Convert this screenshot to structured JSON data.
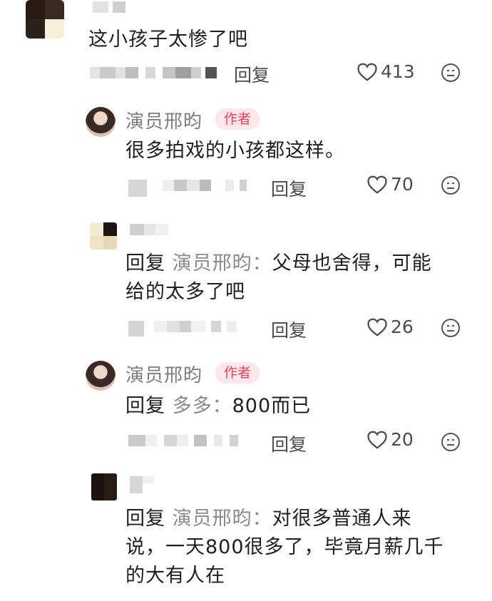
{
  "comments": [
    {
      "text": "这小孩子太惨了吧",
      "reply_label": "回复",
      "likes": "413"
    },
    {
      "author": "演员邢昀",
      "badge": "作者",
      "text": "很多拍戏的小孩都这样。",
      "reply_label": "回复",
      "likes": "70"
    },
    {
      "reply_prefix": "回复",
      "reply_target": "演员邢昀：",
      "text_line1": "父母也舍得，可能",
      "text_line2": "给的太多了吧",
      "reply_label": "回复",
      "likes": "26"
    },
    {
      "author": "演员邢昀",
      "badge": "作者",
      "reply_prefix": "回复",
      "reply_target": "多多：",
      "text": "800而已",
      "reply_label": "回复",
      "likes": "20"
    },
    {
      "reply_prefix": "回复",
      "reply_target": "演员邢昀：",
      "text_line1": "对很多普通人来",
      "text_line2": "说，一天800很多了，毕竟月薪几千",
      "text_line3": "的大有人在"
    }
  ],
  "icons": {
    "like": "heart-outline-icon",
    "dislike": "unhappy-face-icon"
  }
}
